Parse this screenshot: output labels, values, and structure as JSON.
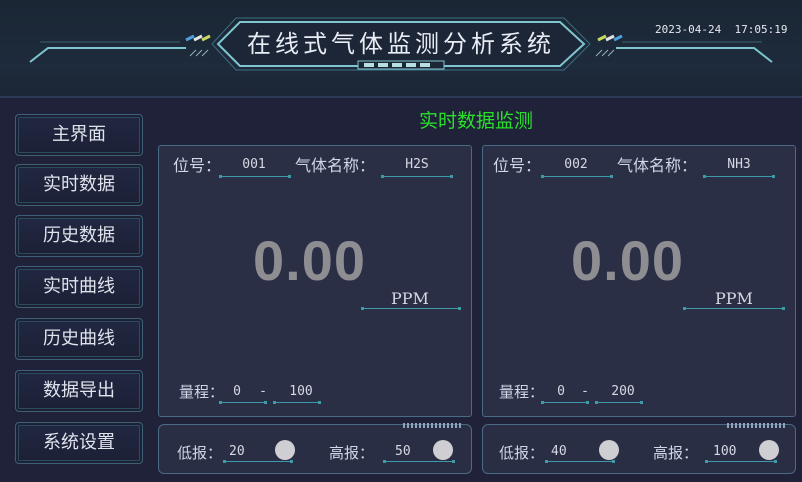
{
  "header": {
    "title": "在线式气体监测分析系统",
    "datetime": "2023-04-24  17:05:19"
  },
  "sidebar": {
    "items": [
      {
        "label": "主界面"
      },
      {
        "label": "实时数据"
      },
      {
        "label": "历史数据"
      },
      {
        "label": "实时曲线"
      },
      {
        "label": "历史曲线"
      },
      {
        "label": "数据导出"
      },
      {
        "label": "系统设置"
      }
    ]
  },
  "main": {
    "title": "实时数据监测",
    "common": {
      "position_label": "位号：",
      "gas_name_label": "气体名称：",
      "range_label": "量程：",
      "range_sep": "-",
      "low_alarm_label": "低报：",
      "high_alarm_label": "高报："
    },
    "panels": [
      {
        "position": "001",
        "gas": "H2S",
        "reading": "0.00",
        "unit": "PPM",
        "range_min": "0",
        "range_max": "100",
        "low_alarm": "20",
        "high_alarm": "50"
      },
      {
        "position": "002",
        "gas": "NH3",
        "reading": "0.00",
        "unit": "PPM",
        "range_min": "0",
        "range_max": "200",
        "low_alarm": "40",
        "high_alarm": "100"
      }
    ]
  },
  "colors": {
    "background": "#1f2238",
    "title_green": "#2be02b",
    "reading_gray": "#8e8e92",
    "accent_cyan": "#3f9aa8",
    "alarm_lamp": "#cfcfd3"
  }
}
